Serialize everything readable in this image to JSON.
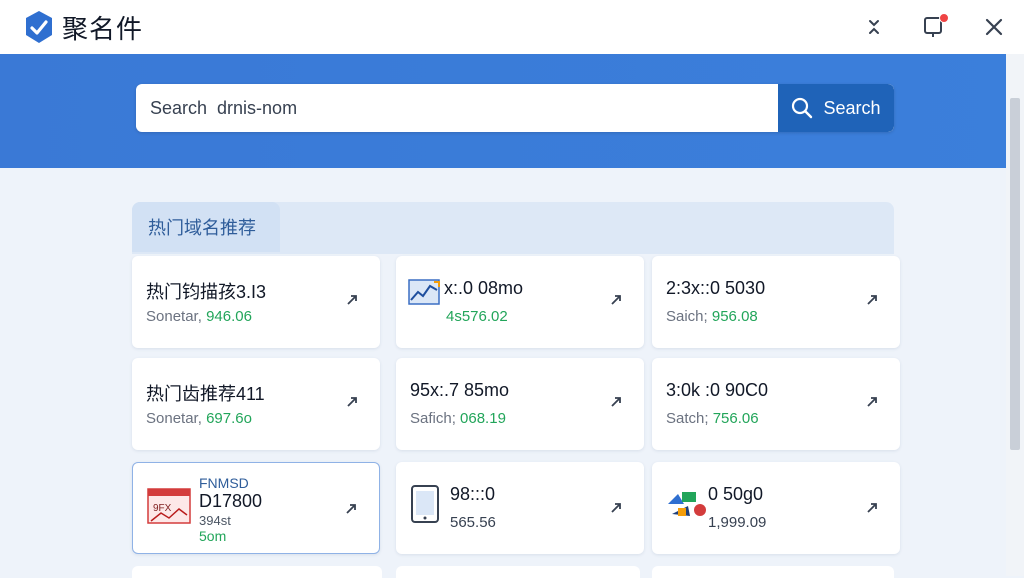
{
  "app": {
    "title": "聚名件",
    "logo_icon": "check-shield-icon"
  },
  "titlebar_icons": [
    "collapse-icon",
    "notification-icon",
    "close-icon"
  ],
  "search": {
    "value": "Search  drnis-nom",
    "button_label": "Search",
    "button_icon": "search-icon"
  },
  "section": {
    "title": "热门域名推荐"
  },
  "cards": [
    {
      "title": "热门钧描孩3.I3",
      "meta_label": "Sonetar,",
      "price": "946.06"
    },
    {
      "title": "x:.0 08mo",
      "meta_label": "",
      "price": "4s576.02",
      "thumb": "chart-thumbnail-icon"
    },
    {
      "title": "2:3x::0 5030",
      "meta_label": "Saich;",
      "price": "956.08"
    },
    {
      "title": "热门齿推荐411",
      "meta_label": "Sonetar,",
      "price": "697.6o"
    },
    {
      "title": "95x:.7 85mo",
      "meta_label": "Safich;",
      "price": "068.19"
    },
    {
      "title": "3:0k :0 90C0",
      "meta_label": "Satch;",
      "price": "756.06"
    },
    {
      "title": "FNMSD",
      "title2": "D17800",
      "meta_label": "394st",
      "price": "5om",
      "thumb": "browser-thumbnail-icon"
    },
    {
      "title": "98:::0",
      "meta_label": "565.56",
      "price": "",
      "thumb": "tablet-icon"
    },
    {
      "title": "0 50g0",
      "meta_label": "1,999.09",
      "price": "",
      "thumb": "shapes-icon"
    }
  ],
  "colors": {
    "accent": "#3a79d6",
    "button": "#1f63b8",
    "price": "#22a55a",
    "background": "#eef3fa"
  }
}
